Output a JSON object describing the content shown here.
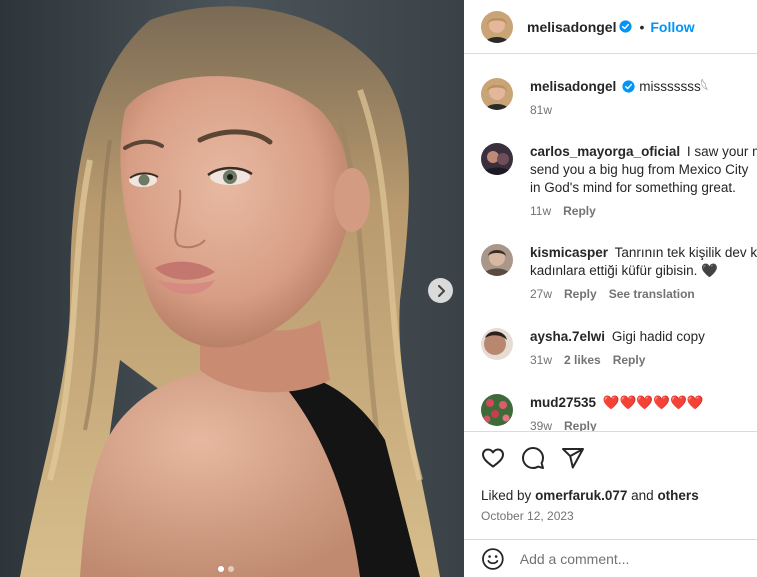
{
  "post": {
    "username": "melisadongel",
    "separator": "•",
    "follow_label": "Follow",
    "caption_text": "misssssss",
    "caption_emoji": "𓆩",
    "caption_time": "81w",
    "carousel": {
      "slide_count": 2,
      "active_index": 0
    }
  },
  "comments": [
    {
      "username": "carlos_mayorga_oficial",
      "lines": [
        "I saw your me",
        "send you a big hug from Mexico City",
        "in God's mind for something great."
      ],
      "time": "11w",
      "likes": "",
      "actions": [
        "Reply"
      ]
    },
    {
      "username": "kismicasper",
      "lines": [
        "Tanrının tek kişilik dev ka",
        "kadınlara ettiği küfür gibisin. 🖤"
      ],
      "time": "27w",
      "likes": "",
      "actions": [
        "Reply",
        "See translation"
      ]
    },
    {
      "username": "aysha.7elwi",
      "lines": [
        "Gigi hadid copy"
      ],
      "time": "31w",
      "likes": "2 likes",
      "actions": [
        "Reply"
      ]
    },
    {
      "username": "mud27535",
      "lines": [
        "❤️❤️❤️❤️❤️❤️"
      ],
      "time": "39w",
      "likes": "",
      "actions": [
        "Reply"
      ]
    }
  ],
  "footer": {
    "liked_prefix": "Liked by",
    "liked_user": "omerfaruk.077",
    "liked_and": "and",
    "liked_others": "others",
    "date": "October 12, 2023",
    "comment_placeholder": "Add a comment..."
  },
  "colors": {
    "accent": "#0095f6",
    "verified": "#0095f6",
    "muted": "#737373",
    "divider": "#dbdbdb"
  }
}
